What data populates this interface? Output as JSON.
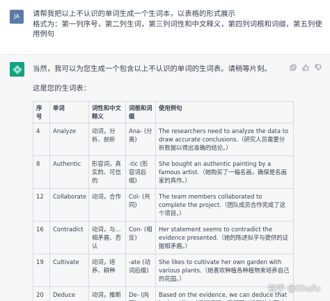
{
  "user": {
    "avatar": "JA",
    "lines": [
      "请帮我把以上不认识的单词生成一个生词本，以表格的形式展示",
      "格式为：第一列序号，第二列生词，第三列词性和中文释义，第四列词根和词缀，第五列使",
      "用例句"
    ]
  },
  "assistant": {
    "intro": "当然，我可以为您生成一个包含以上不认识的单词的生词表。请稍等片刻。",
    "subtitle": "这是您的生词表：",
    "icons": [
      "copy-icon",
      "thumbs-up-icon",
      "thumbs-down-icon"
    ]
  },
  "table": {
    "headers": [
      "序号",
      "单词",
      "词性和中文释义",
      "词根和词缀",
      "使用例句"
    ],
    "rows": [
      [
        "4",
        "Analyze",
        "动词，分析、剖析",
        "Ana- (分离)",
        "The researchers need to analyze the data to draw accurate conclusions.（研究人员需要分析数据以得出准确的结论。）"
      ],
      [
        "8",
        "Authentic",
        "形容词，真实的、可信的",
        "-tic (形容词后缀)",
        "She bought an authentic painting by a famous artist.（她购买了一幅名画，确保是名画家的真作。）"
      ],
      [
        "12",
        "Collaborate",
        "动词，合作",
        "Col- (共同)",
        "The team members collaborated to complete the project.（团队成员合作完成了这个项目。）"
      ],
      [
        "16",
        "Contradict",
        "动词，与...相矛盾、否认",
        "Con- (相反)",
        "Her statement seems to contradict the evidence presented.（她的陈述似乎与提供的证据相矛盾。）"
      ],
      [
        "19",
        "Cultivate",
        "动词，培养、耕种",
        "-ate (动词后缀)",
        "She likes to cultivate her own garden with various plants.（她喜欢种植各种植物来培养自己的花园。）"
      ],
      [
        "20",
        "Deduce",
        "动词，推断",
        "De- (向下)",
        "Based on the evidence, we can deduce that he is guilty.（根据证据，我们可以推断他有罪。）"
      ]
    ]
  },
  "watermark": "知乎 @Khufu",
  "colors": {
    "gpt_green": "#10a37f",
    "user_avatar": "#5a7aa8",
    "assistant_bg": "#f7f7f8"
  }
}
